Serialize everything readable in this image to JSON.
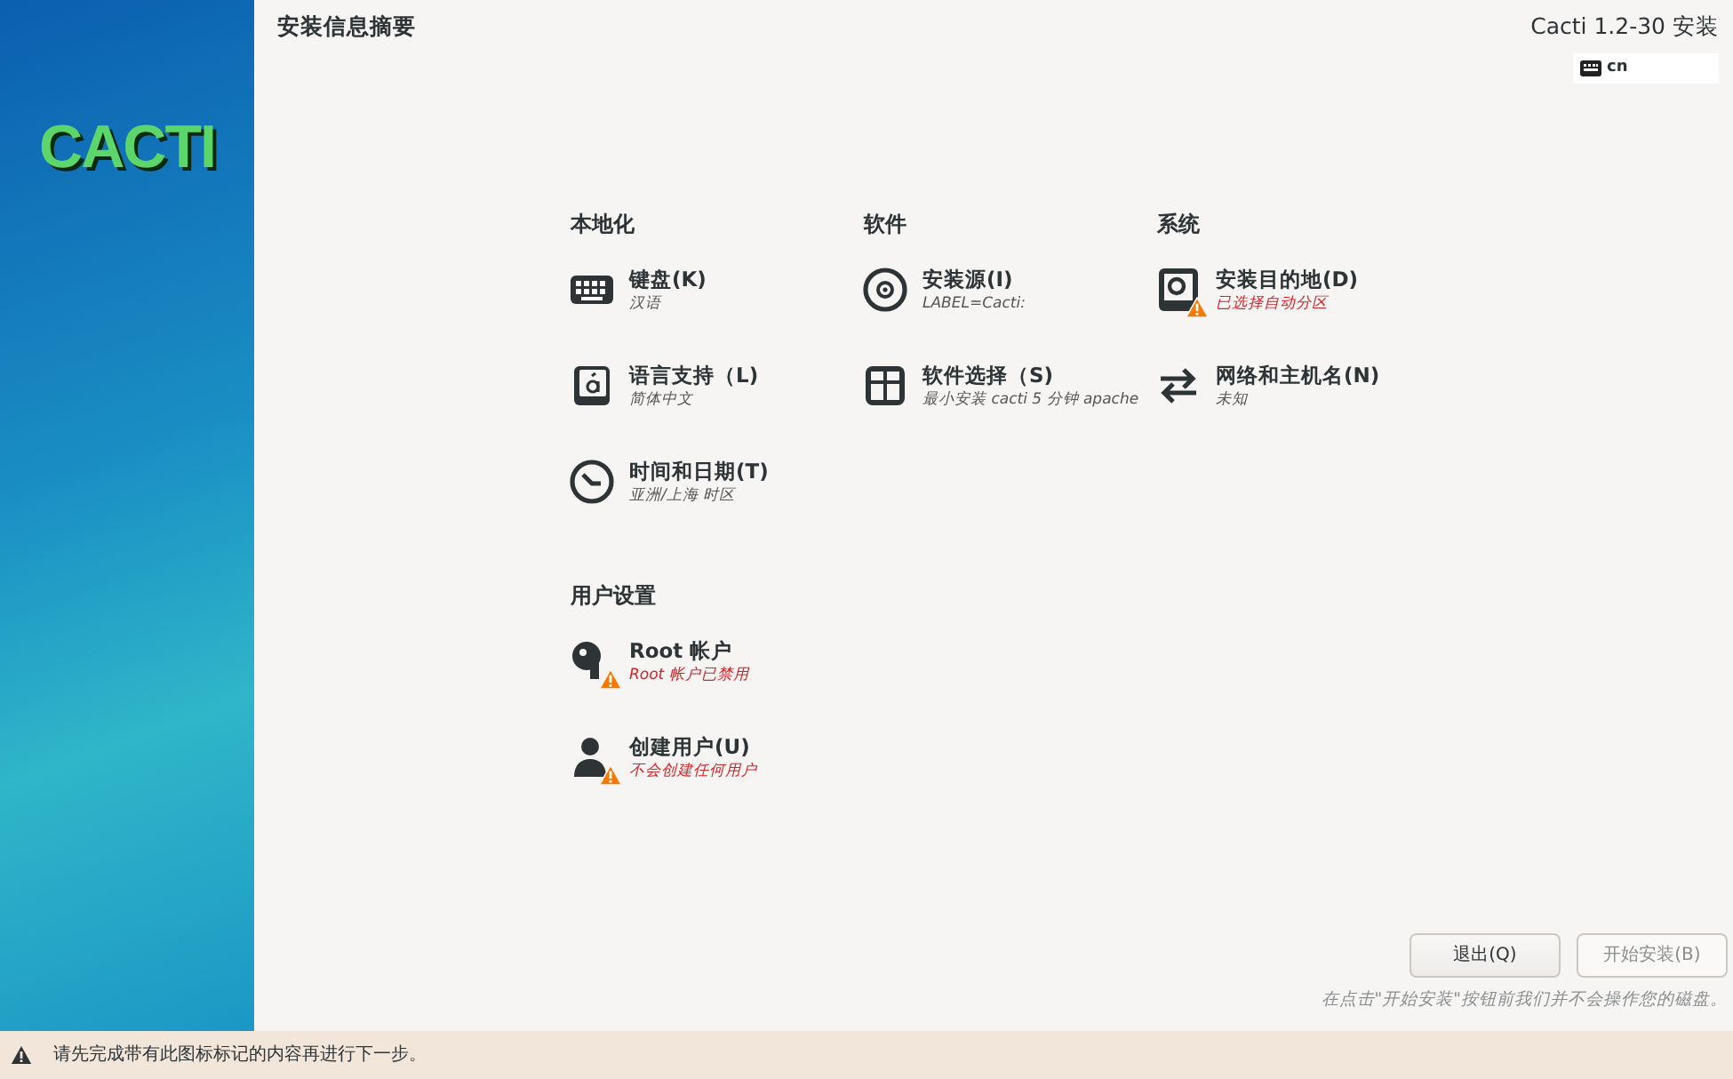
{
  "sidebar": {
    "logo": "CACTI"
  },
  "header": {
    "title": "安装信息摘要",
    "product": "Cacti 1.2-30 安装",
    "keyboard_layout": "cn"
  },
  "sections": [
    {
      "title": "本地化",
      "items": [
        {
          "title": "键盘(K)",
          "status": "汉语",
          "warning": false
        },
        {
          "title": "语言支持（L)",
          "status": "简体中文",
          "warning": false
        },
        {
          "title": "时间和日期(T)",
          "status": "亚洲/上海 时区",
          "warning": false
        }
      ]
    },
    {
      "title": "软件",
      "items": [
        {
          "title": "安装源(I)",
          "status": "LABEL=Cacti:",
          "warning": false
        },
        {
          "title": "软件选择（S)",
          "status": "最小安装 cacti 5 分钟 apache",
          "warning": false
        }
      ]
    },
    {
      "title": "系统",
      "items": [
        {
          "title": "安装目的地(D)",
          "status": "已选择自动分区",
          "warning": true
        },
        {
          "title": "网络和主机名(N)",
          "status": "未知",
          "warning": false
        }
      ]
    },
    {
      "title": "用户设置",
      "items": [
        {
          "title": "Root 帐户",
          "status": "Root 帐户已禁用",
          "warning": true
        },
        {
          "title": "创建用户(U)",
          "status": "不会创建任何用户",
          "warning": true
        }
      ]
    }
  ],
  "buttons": [
    {
      "label": "退出(Q)",
      "disabled": false
    },
    {
      "label": "开始安装(B)",
      "disabled": true
    }
  ],
  "note": "在点击\"开始安装\"按钮前我们并不会操作您的磁盘。",
  "warning_bar": "请先完成带有此图标标记的内容再进行下一步。"
}
